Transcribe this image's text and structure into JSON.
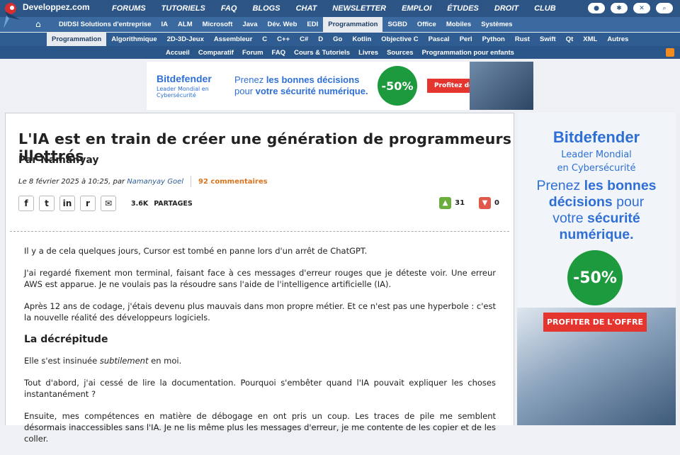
{
  "site": {
    "logo_text": "Developpez.com"
  },
  "topnav": [
    "FORUMS",
    "TUTORIELS",
    "FAQ",
    "BLOGS",
    "CHAT",
    "NEWSLETTER",
    "EMPLOI",
    "ÉTUDES",
    "DROIT",
    "CLUB"
  ],
  "nav2": [
    "DI/DSI Solutions d'entreprise",
    "IA",
    "ALM",
    "Microsoft",
    "Java",
    "Dév. Web",
    "EDI",
    "Programmation",
    "SGBD",
    "Office",
    "Mobiles",
    "Systèmes"
  ],
  "nav2_active": "Programmation",
  "nav3": [
    "Programmation",
    "Algorithmique",
    "2D-3D-Jeux",
    "Assembleur",
    "C",
    "C++",
    "C#",
    "D",
    "Go",
    "Kotlin",
    "Objective C",
    "Pascal",
    "Perl",
    "Python",
    "Rust",
    "Swift",
    "Qt",
    "XML",
    "Autres"
  ],
  "nav4": [
    "Accueil",
    "Comparatif",
    "Forum",
    "FAQ",
    "Cours & Tutoriels",
    "Livres",
    "Sources",
    "Programmation pour enfants"
  ],
  "banner": {
    "brand": "Bitdefender",
    "sub": "Leader Mondial en Cybersécurité",
    "line1_pre": "Prenez ",
    "line1_bold": "les bonnes décisions",
    "line2_pre": "pour ",
    "line2_bold": "votre sécurité numérique.",
    "discount": "-50%",
    "button": "Profitez de l'offre"
  },
  "article": {
    "title": "L'IA est en train de créer une génération de programmeurs illettrés",
    "author": "Par Namanyay",
    "date_prefix": "Le 8 février 2025 à 10:25, par ",
    "date_author": "Namanyay Goel",
    "comments": "92 commentaires",
    "share_count": "3.6K",
    "share_label": "PARTAGES",
    "votes_up": "31",
    "votes_down": "0",
    "paragraphs": [
      "Il y a de cela quelques jours, Cursor est tombé en panne lors d'un arrêt de ChatGPT.",
      "J'ai regardé fixement mon terminal, faisant face à ces messages d'erreur rouges que je déteste voir. Une erreur AWS est apparue. Je ne voulais pas la résoudre sans l'aide de l'intelligence artificielle (IA).",
      "Après 12 ans de codage, j'étais devenu plus mauvais dans mon propre métier. Et ce n'est pas une hyperbole : c'est la nouvelle réalité des développeurs logiciels."
    ],
    "subheading": "La décrépitude",
    "p4_pre": "Elle s'est insinuée ",
    "p4_em": "subtilement",
    "p4_post": " en moi.",
    "paragraphs2": [
      "Tout d'abord, j'ai cessé de lire la documentation. Pourquoi s'embêter quand l'IA pouvait expliquer les choses instantanément ?",
      "Ensuite, mes compétences en matière de débogage en ont pris un coup. Les traces de pile me semblent désormais inaccessibles sans l'IA. Je ne lis même plus les messages d'erreur, je me contente de les copier et de les coller."
    ]
  },
  "sidebar_ad": {
    "brand": "Bitdefender",
    "sub1": "Leader Mondial",
    "sub2": "en Cybersécurité",
    "l1_pre": "Prenez ",
    "l1_bold": "les bonnes",
    "l2_bold": "décisions",
    "l2_post": " pour",
    "l3_pre": "votre ",
    "l3_bold": "sécurité",
    "l4_bold": "numérique.",
    "discount": "-50%",
    "button": "PROFITER DE L'OFFRE"
  },
  "colors": {
    "primary": "#2c5585",
    "accent": "#d9741c",
    "ad_blue": "#2e6fd6",
    "ad_green": "#1d9a3d",
    "ad_red": "#e4362f"
  }
}
